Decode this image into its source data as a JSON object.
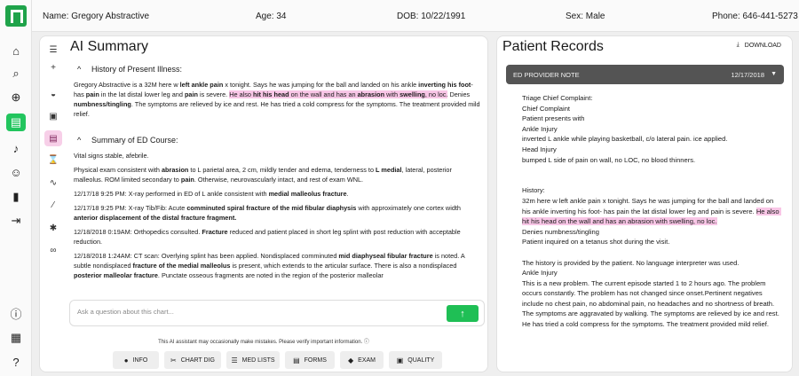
{
  "header": {
    "name_label": "Name:",
    "name_value": "Gregory Abstractive",
    "age_label": "Age:",
    "age_value": "34",
    "dob_label": "DOB:",
    "dob_value": "10/22/1991",
    "sex_label": "Sex:",
    "sex_value": "Male",
    "phone_label": "Phone:",
    "phone_value": "646-441-5273"
  },
  "nav": {
    "icons": [
      "home-icon",
      "search-icon",
      "add-document-icon",
      "notes-icon",
      "bell-icon",
      "person-icon",
      "bar-chart-icon",
      "logout-icon",
      "info-icon",
      "calendar-icon",
      "help-icon"
    ],
    "active": "notes-icon"
  },
  "ai": {
    "title": "AI Summary",
    "tools": [
      "collapse-list-icon",
      "plus-icon",
      "pill-icon",
      "image-icon",
      "documents-icon",
      "hourglass-icon",
      "pulse-icon",
      "syringe-icon",
      "asterisk-icon",
      "link-icon"
    ],
    "active_tool": "documents-icon",
    "section1_title": "History of Present Illness:",
    "hpi": [
      {
        "t": "Gregory Abstractive is a 32M here w ",
        "b": false,
        "h": false
      },
      {
        "t": "left ankle pain",
        "b": true,
        "h": false
      },
      {
        "t": " x tonight. Says he was jumping for the ball and landed on his ankle ",
        "b": false,
        "h": false
      },
      {
        "t": "inverting his foot",
        "b": true,
        "h": false
      },
      {
        "t": "- has ",
        "b": false,
        "h": false
      },
      {
        "t": "pain",
        "b": true,
        "h": false
      },
      {
        "t": " in the lat distal lower leg and ",
        "b": false,
        "h": false
      },
      {
        "t": "pain",
        "b": true,
        "h": false
      },
      {
        "t": " is severe. ",
        "b": false,
        "h": false
      },
      {
        "t": "He also ",
        "b": false,
        "h": true
      },
      {
        "t": "hit his head",
        "b": true,
        "h": true
      },
      {
        "t": " on the wall and has an ",
        "b": false,
        "h": true
      },
      {
        "t": "abrasion",
        "b": true,
        "h": true
      },
      {
        "t": " with ",
        "b": false,
        "h": true
      },
      {
        "t": "swelling",
        "b": true,
        "h": true
      },
      {
        "t": ", no loc.",
        "b": false,
        "h": true
      },
      {
        "t": " Denies ",
        "b": false,
        "h": false
      },
      {
        "t": "numbness/tingling",
        "b": true,
        "h": false
      },
      {
        "t": ". The symptoms are relieved by ice and rest. He has tried a cold compress for the symptoms. The treatment provided mild relief.",
        "b": false,
        "h": false
      }
    ],
    "section2_title": "Summary of ED Course:",
    "course": [
      [
        {
          "t": "Vital signs stable, afebrile.",
          "b": false
        }
      ],
      [
        {
          "t": "Physical exam consistent with ",
          "b": false
        },
        {
          "t": "abrasion",
          "b": true
        },
        {
          "t": " to L parietal area, 2 cm, mildly tender and edema, tenderness to ",
          "b": false
        },
        {
          "t": "L medial",
          "b": true
        },
        {
          "t": ", lateral, posterior malleolus. ROM limited secondary to ",
          "b": false
        },
        {
          "t": "pain",
          "b": true
        },
        {
          "t": ". Otherwise, neurovascularly intact, and rest of exam WNL.",
          "b": false
        }
      ],
      [
        {
          "t": "12/17/18 9:25 PM: X-ray performed in ED of L ankle consistent with ",
          "b": false
        },
        {
          "t": "medial malleolus fracture",
          "b": true
        },
        {
          "t": ".",
          "b": false
        }
      ],
      [
        {
          "t": "12/17/18 9:25 PM: X-ray Tib/Fib: Acute ",
          "b": false
        },
        {
          "t": "comminuted spiral fracture of the mid fibular diaphysis",
          "b": true
        },
        {
          "t": " with approximately one cortex width ",
          "b": false
        },
        {
          "t": "anterior displacement of the distal fracture fragment.",
          "b": true
        }
      ],
      [
        {
          "t": "12/18/2018 0:19AM: Orthopedics consulted. ",
          "b": false
        },
        {
          "t": "Fracture",
          "b": true
        },
        {
          "t": " reduced and patient placed in short leg splint with post reduction with acceptable reduction.",
          "b": false
        }
      ],
      [
        {
          "t": "12/18/2018 1:24AM: CT scan: Overlying splint has been applied. Nondisplaced comminuted ",
          "b": false
        },
        {
          "t": "mid diaphyseal fibular fracture",
          "b": true
        },
        {
          "t": " is noted. A subtle nondisplaced ",
          "b": false
        },
        {
          "t": "fracture of the medial malleolus",
          "b": true
        },
        {
          "t": " is present, which extends to the articular surface. There is also a nondisplaced ",
          "b": false
        },
        {
          "t": "posterior malleolar fracture",
          "b": true
        },
        {
          "t": ". Punctate osseous fragments are noted in the region of the posterior malleolar",
          "b": false
        }
      ]
    ],
    "ask_placeholder": "Ask a question about this chart...",
    "disclaimer": "This AI assistant may occasionally make mistakes. Please verify important information.",
    "buttons": [
      {
        "label": "INFO",
        "icon": "info-icon",
        "glyph": "●"
      },
      {
        "label": "CHART DIG",
        "icon": "tools-icon",
        "glyph": "✂"
      },
      {
        "label": "MED LISTS",
        "icon": "list-icon",
        "glyph": "☰"
      },
      {
        "label": "FORMS",
        "icon": "form-icon",
        "glyph": "▤"
      },
      {
        "label": "EXAM",
        "icon": "graduation-cap-icon",
        "glyph": "◆"
      },
      {
        "label": "QUALITY",
        "icon": "quality-icon",
        "glyph": "▣"
      }
    ]
  },
  "records": {
    "title": "Patient Records",
    "download_label": "DOWNLOAD",
    "note_label": "ED PROVIDER NOTE",
    "note_date": "12/17/2018",
    "body_before": "Triage Chief Complaint:\nChief Complaint\nPatient presents with\nAnkle Injury\ninverted L ankle while playing basketball, c/o lateral pain. ice applied.\nHead Injury\nbumped L side of pain on wall, no LOC, no blood thinners.\n\n\nHistory:\n32m here w left ankle pain x tonight. Says he was jumping for the ball and landed on his ankle inverting his foot- has pain the lat distal lower leg and pain is severe. ",
    "body_highlight": "He also hit his head on the wall and has an abrasion with swelling, no loc.",
    "body_after": "\nDenies numbness/tingling\nPatient inquired on a tetanus shot during the visit.\n\nThe history is provided by the patient. No language interpreter was used.\nAnkle Injury\nThis is a new problem. The current episode started 1 to 2 hours ago. The problem occurs constantly. The problem has not changed since onset.Pertinent negatives include no chest pain, no abdominal pain, no headaches and no shortness of breath. The symptoms are aggravated by walking. The symptoms are relieved by ice and rest. He has tried a cold compress for the symptoms. The treatment provided mild relief."
  }
}
